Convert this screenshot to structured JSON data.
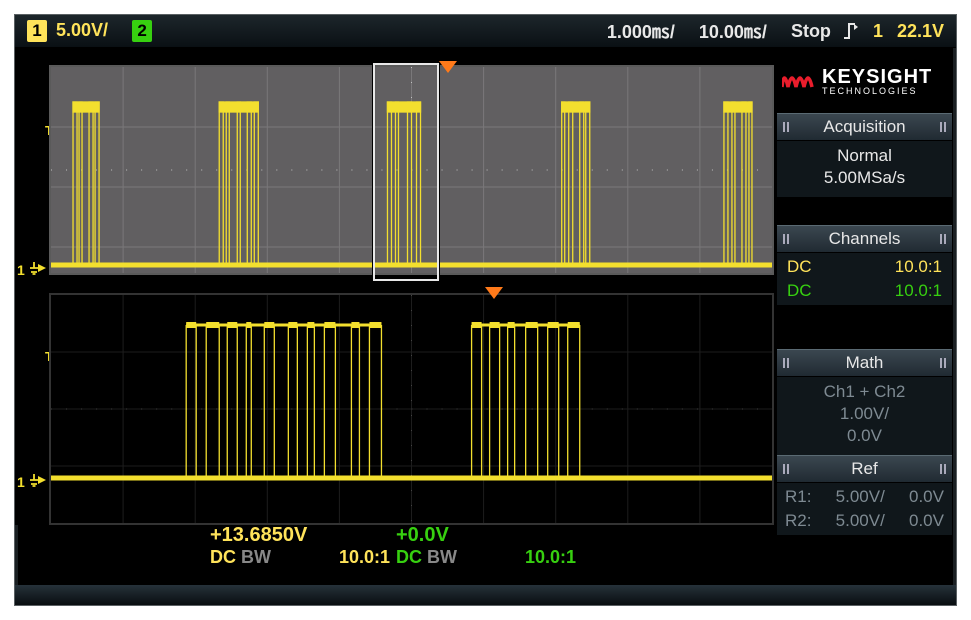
{
  "topbar": {
    "ch1_badge": "1",
    "ch1_scale": "5.00V/",
    "ch2_badge": "2",
    "time_div": "1.000㎳/",
    "time_pos": "10.00㎳/",
    "run_state": "Stop",
    "trig_ch": "1",
    "trig_level": "22.1V"
  },
  "status": {
    "ch1_value": "+13.6850V",
    "ch1_coupling": "DC",
    "ch1_bw": "BW",
    "ch1_probe": "10.0:1",
    "ch2_value": "+0.0V",
    "ch2_coupling": "DC",
    "ch2_bw": "BW",
    "ch2_probe": "10.0:1"
  },
  "logo": {
    "brand": "KEYSIGHT",
    "sub": "TECHNOLOGIES"
  },
  "sidebar": {
    "acquisition": {
      "title": "Acquisition",
      "mode": "Normal",
      "rate": "5.00MSa/s"
    },
    "channels": {
      "title": "Channels",
      "rows": [
        {
          "coupling": "DC",
          "probe": "10.0:1",
          "color": "y1"
        },
        {
          "coupling": "DC",
          "probe": "10.0:1",
          "color": "g1"
        }
      ]
    },
    "math": {
      "title": "Math",
      "op": "Ch1 + Ch2",
      "scale": "1.00V/",
      "offset": "0.0V"
    },
    "ref": {
      "title": "Ref",
      "rows": [
        {
          "name": "R1:",
          "scale": "5.00V/",
          "offset": "0.0V"
        },
        {
          "name": "R2:",
          "scale": "5.00V/",
          "offset": "0.0V"
        }
      ]
    }
  },
  "markers": {
    "t_label": "T",
    "gnd_label": "1"
  }
}
